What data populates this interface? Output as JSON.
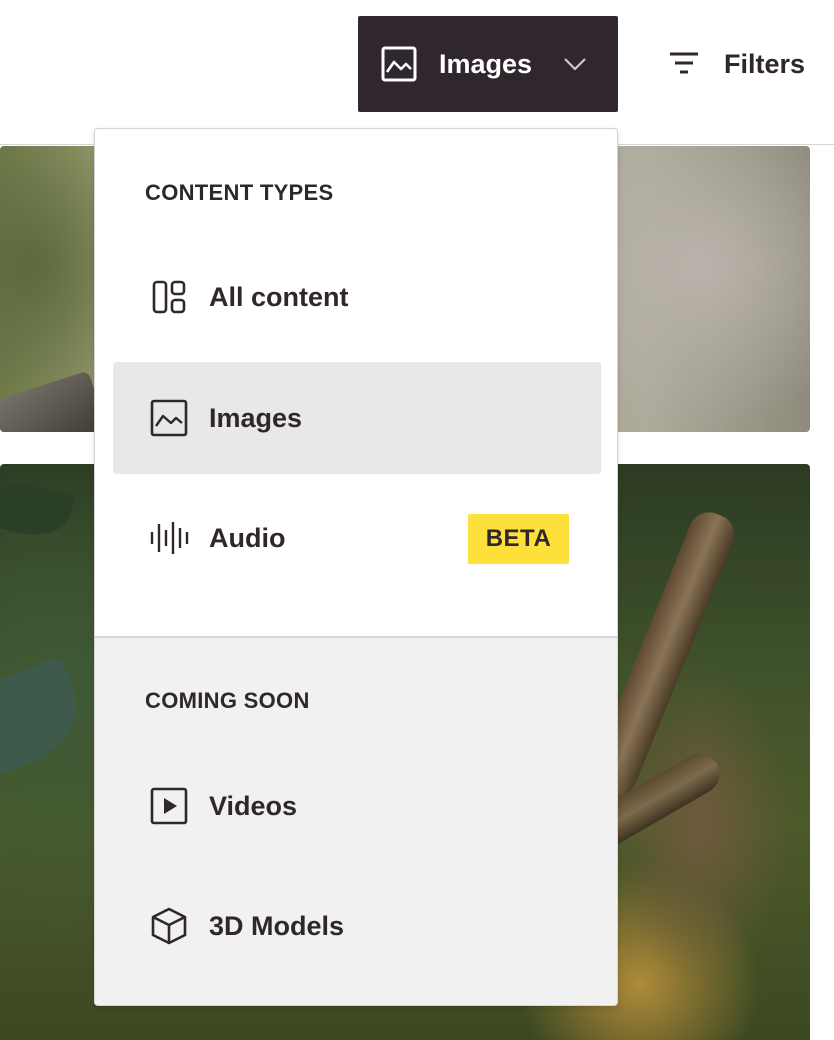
{
  "header": {
    "content_type_button": {
      "label": "Images",
      "icon": "image-icon",
      "dropdown_icon": "chevron-down-icon"
    },
    "filters_button": {
      "label": "Filters",
      "icon": "filter-lines-icon"
    }
  },
  "dropdown": {
    "content_types": {
      "heading": "CONTENT TYPES",
      "items": [
        {
          "label": "All content",
          "icon": "all-content-grid-icon"
        },
        {
          "label": "Images",
          "icon": "image-icon",
          "selected": true
        },
        {
          "label": "Audio",
          "icon": "audio-waveform-icon",
          "badge": "BETA"
        }
      ]
    },
    "coming_soon": {
      "heading": "COMING SOON",
      "items": [
        {
          "label": "Videos",
          "icon": "video-play-icon"
        },
        {
          "label": "3D Models",
          "icon": "cube-icon"
        }
      ]
    }
  },
  "colors": {
    "button_dark": "#30272e",
    "selected_bg": "#e8e8e8",
    "coming_soon_bg": "#f1f1f1",
    "beta_badge": "#fde03a"
  }
}
